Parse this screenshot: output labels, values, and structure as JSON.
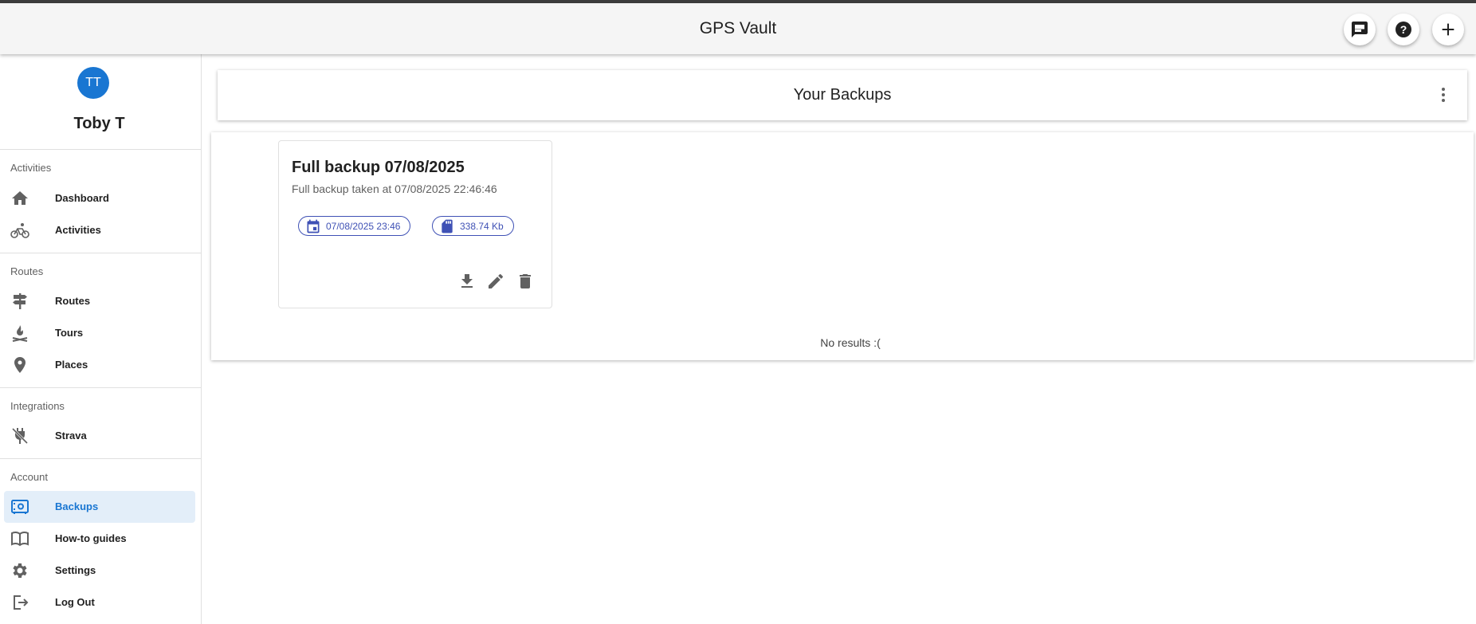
{
  "app": {
    "title": "GPS Vault"
  },
  "appbar": {
    "buttons": [
      {
        "name": "feedback",
        "icon": "feedback-icon"
      },
      {
        "name": "help",
        "icon": "help-icon"
      },
      {
        "name": "add",
        "icon": "plus-icon"
      }
    ]
  },
  "user": {
    "initials": "TT",
    "name": "Toby T"
  },
  "sidebar": {
    "sections": [
      {
        "label": "Activities",
        "items": [
          {
            "label": "Dashboard",
            "icon": "home-icon"
          },
          {
            "label": "Activities",
            "icon": "bicycle-icon"
          }
        ]
      },
      {
        "label": "Routes",
        "items": [
          {
            "label": "Routes",
            "icon": "signpost-icon"
          },
          {
            "label": "Tours",
            "icon": "campfire-icon"
          },
          {
            "label": "Places",
            "icon": "map-pin-icon"
          }
        ]
      },
      {
        "label": "Integrations",
        "items": [
          {
            "label": "Strava",
            "icon": "unplugged-icon"
          }
        ]
      },
      {
        "label": "Account",
        "items": [
          {
            "label": "Backups",
            "icon": "safe-icon",
            "active": true
          },
          {
            "label": "How-to guides",
            "icon": "book-icon"
          },
          {
            "label": "Settings",
            "icon": "gear-icon"
          },
          {
            "label": "Log Out",
            "icon": "logout-icon"
          }
        ]
      }
    ]
  },
  "main": {
    "header_title": "Your Backups",
    "backup": {
      "title": "Full backup 07/08/2025",
      "subtitle": "Full backup taken at 07/08/2025 22:46:46",
      "date_chip": "07/08/2025 23:46",
      "size_chip": "338.74 Kb"
    },
    "no_results": "No results :("
  },
  "colors": {
    "accent": "#1976d2",
    "chip": "#3f51b5",
    "active_bg": "#e3eef9"
  }
}
